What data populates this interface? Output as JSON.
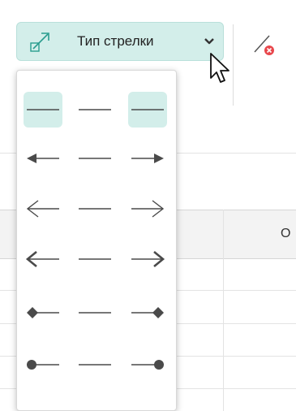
{
  "toolbar": {
    "arrow_type_label": "Тип стрелки",
    "arrow_type_icon": "diagonal-double-arrow-icon",
    "dropdown_icon": "chevron-down-icon",
    "remove_icon": "line-with-red-x-icon"
  },
  "sheet": {
    "column_header_partial": "О"
  },
  "arrow_menu": {
    "rows": [
      {
        "start": "none",
        "end": "none",
        "selected": true
      },
      {
        "start": "triangle-filled",
        "end": "triangle-filled",
        "selected": false
      },
      {
        "start": "open-arrow",
        "end": "open-arrow",
        "selected": false
      },
      {
        "start": "stealth-arrow",
        "end": "stealth-arrow",
        "selected": false
      },
      {
        "start": "diamond",
        "end": "diamond",
        "selected": false
      },
      {
        "start": "circle",
        "end": "circle",
        "selected": false
      }
    ]
  },
  "colors": {
    "accent": "#d3eeea",
    "line": "#4a4a4a",
    "danger": "#e8474c"
  }
}
